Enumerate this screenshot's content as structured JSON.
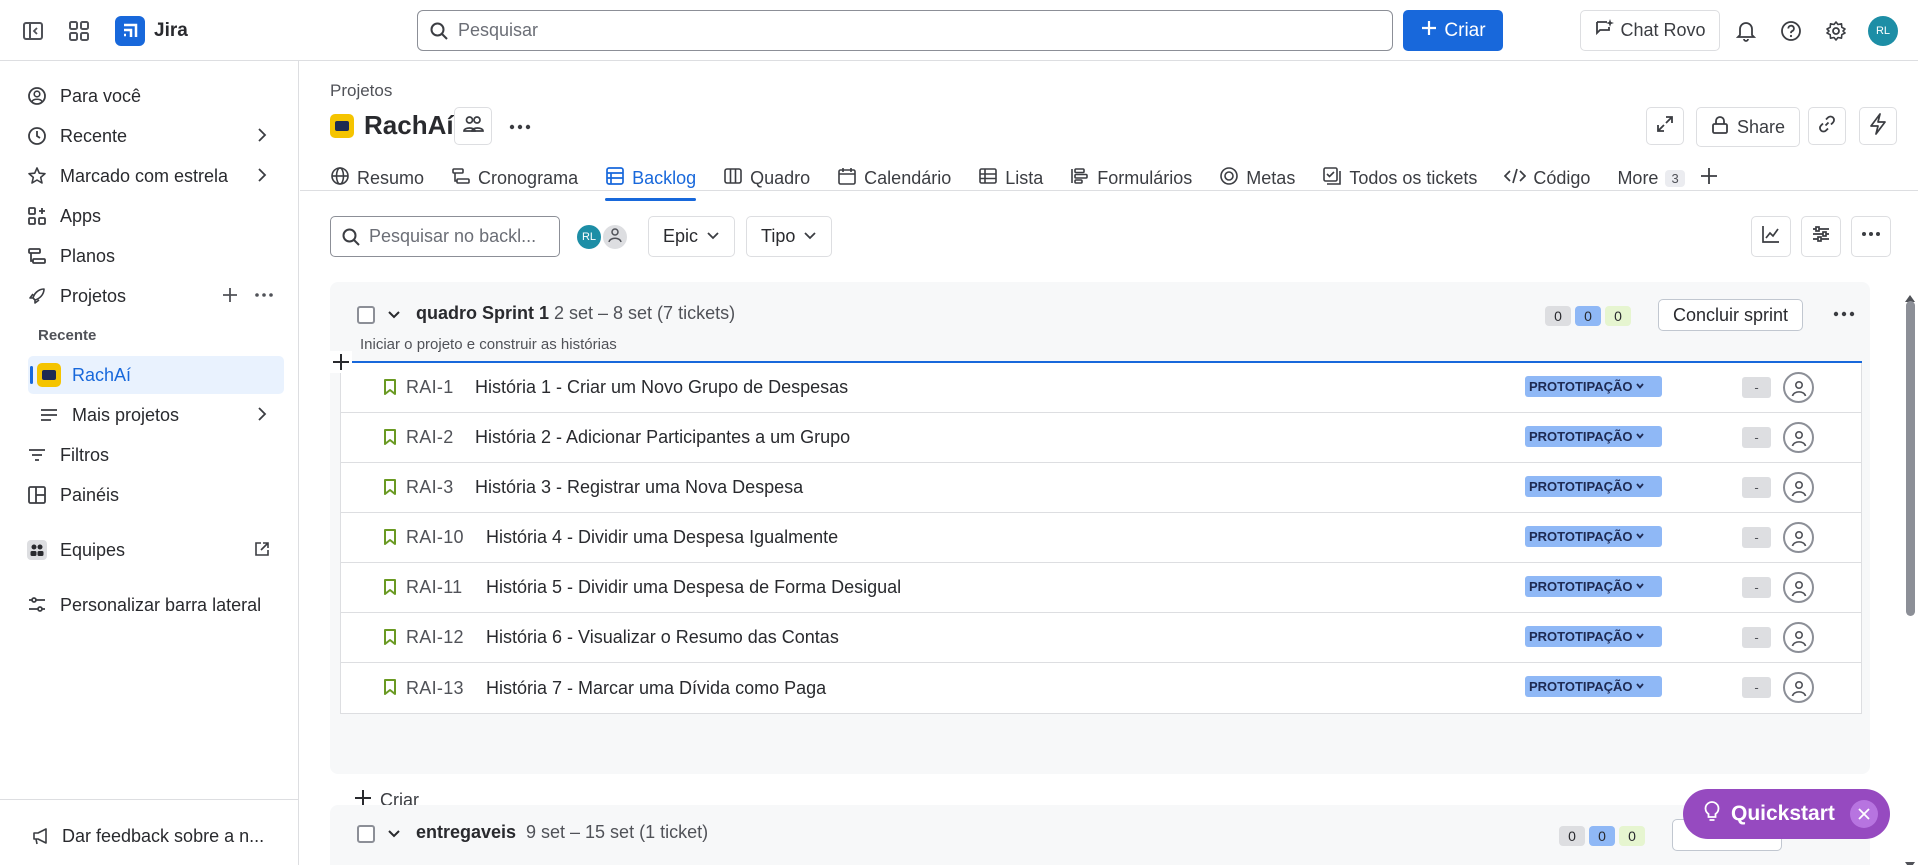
{
  "topbar": {
    "app_name": "Jira",
    "search_placeholder": "Pesquisar",
    "create_label": "Criar",
    "chat_rovo_label": "Chat Rovo",
    "avatar_initials": "RL"
  },
  "sidebar": {
    "items": [
      {
        "label": "Para você",
        "icon": "person-circle-icon"
      },
      {
        "label": "Recente",
        "icon": "clock-icon"
      },
      {
        "label": "Marcado com estrela",
        "icon": "star-icon"
      },
      {
        "label": "Apps",
        "icon": "apps-icon"
      },
      {
        "label": "Planos",
        "icon": "plans-icon"
      },
      {
        "label": "Projetos",
        "icon": "rocket-icon"
      }
    ],
    "recent_label": "Recente",
    "project_item": "RachAí",
    "more_projects": "Mais projetos",
    "filters": "Filtros",
    "dashboards": "Painéis",
    "teams": "Equipes",
    "customize": "Personalizar barra lateral",
    "feedback": "Dar feedback sobre a n..."
  },
  "project": {
    "breadcrumb": "Projetos",
    "name": "RachAí",
    "share_label": "Share"
  },
  "tabs": [
    {
      "label": "Resumo",
      "icon": "globe-icon"
    },
    {
      "label": "Cronograma",
      "icon": "timeline-icon"
    },
    {
      "label": "Backlog",
      "icon": "backlog-icon",
      "active": true
    },
    {
      "label": "Quadro",
      "icon": "board-icon"
    },
    {
      "label": "Calendário",
      "icon": "calendar-icon"
    },
    {
      "label": "Lista",
      "icon": "list-icon"
    },
    {
      "label": "Formulários",
      "icon": "forms-icon"
    },
    {
      "label": "Metas",
      "icon": "goals-icon"
    },
    {
      "label": "Todos os tickets",
      "icon": "tickets-icon"
    },
    {
      "label": "Código",
      "icon": "code-icon"
    }
  ],
  "more_tab": {
    "label": "More",
    "count": "3"
  },
  "toolbar": {
    "search_placeholder": "Pesquisar no backl...",
    "avatar_initials": "RL",
    "epic_label": "Epic",
    "type_label": "Tipo"
  },
  "sprint1": {
    "name": "quadro Sprint 1",
    "dates": "2 set – 8 set (7 tickets)",
    "goal": "Iniciar o projeto e construir as histórias",
    "counts": [
      "0",
      "0",
      "0"
    ],
    "complete_label": "Concluir sprint",
    "create_label": "Criar",
    "issues": [
      {
        "key": "RAI-1",
        "summary": "História 1 - Criar um Novo Grupo de Despesas",
        "epic": "PROTOTIPAÇÃO",
        "estimate": "-"
      },
      {
        "key": "RAI-2",
        "summary": "História 2 - Adicionar Participantes a um Grupo",
        "epic": "PROTOTIPAÇÃO",
        "estimate": "-"
      },
      {
        "key": "RAI-3",
        "summary": "História 3 - Registrar uma Nova Despesa",
        "epic": "PROTOTIPAÇÃO",
        "estimate": "-"
      },
      {
        "key": "RAI-10",
        "summary": "História 4 - Dividir uma Despesa Igualmente",
        "epic": "PROTOTIPAÇÃO",
        "estimate": "-"
      },
      {
        "key": "RAI-11",
        "summary": "História 5 - Dividir uma Despesa de Forma Desigual",
        "epic": "PROTOTIPAÇÃO",
        "estimate": "-"
      },
      {
        "key": "RAI-12",
        "summary": "História 6 - Visualizar o Resumo das Contas",
        "epic": "PROTOTIPAÇÃO",
        "estimate": "-"
      },
      {
        "key": "RAI-13",
        "summary": "História 7 - Marcar uma Dívida como Paga",
        "epic": "PROTOTIPAÇÃO",
        "estimate": "-"
      }
    ]
  },
  "sprint2": {
    "name": "entregaveis",
    "dates": "9 set – 15 set (1 ticket)",
    "counts": [
      "0",
      "0",
      "0"
    ]
  },
  "quickstart": {
    "label": "Quickstart"
  },
  "colors": {
    "brand": "#1868db",
    "epic": "#8fb8f6",
    "quickstart": "#964ac0",
    "story": "#6a9a23"
  }
}
